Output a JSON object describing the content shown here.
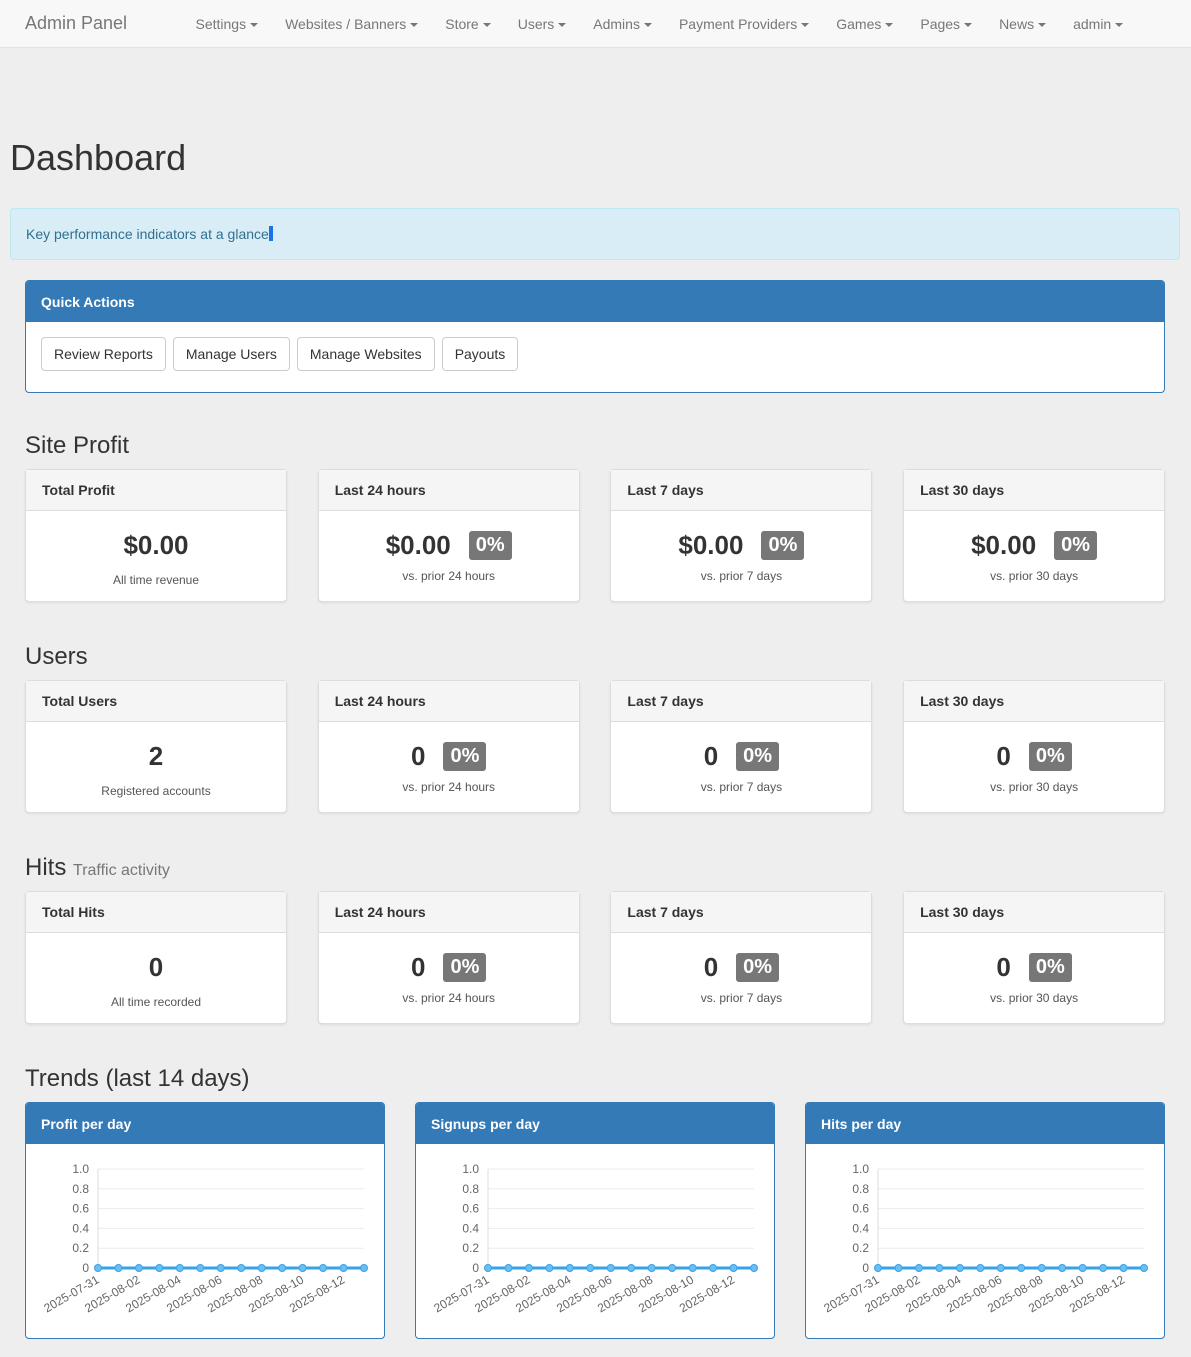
{
  "nav": {
    "brand": "Admin Panel",
    "items": [
      "Settings",
      "Websites / Banners",
      "Store",
      "Users",
      "Admins",
      "Payment Providers",
      "Games",
      "Pages",
      "News",
      "admin"
    ]
  },
  "page_title": "Dashboard",
  "alert": "Key performance indicators at a glance",
  "quick_actions": {
    "title": "Quick Actions",
    "buttons": [
      "Review Reports",
      "Manage Users",
      "Manage Websites",
      "Payouts"
    ]
  },
  "sections": [
    {
      "title": "Site Profit",
      "subtitle": "",
      "cards": [
        {
          "header": "Total Profit",
          "value": "$0.00",
          "badge": "",
          "sub": "All time revenue"
        },
        {
          "header": "Last 24 hours",
          "value": "$0.00",
          "badge": "0%",
          "sub": "vs. prior 24 hours"
        },
        {
          "header": "Last 7 days",
          "value": "$0.00",
          "badge": "0%",
          "sub": "vs. prior 7 days"
        },
        {
          "header": "Last 30 days",
          "value": "$0.00",
          "badge": "0%",
          "sub": "vs. prior 30 days"
        }
      ]
    },
    {
      "title": "Users",
      "subtitle": "",
      "cards": [
        {
          "header": "Total Users",
          "value": "2",
          "badge": "",
          "sub": "Registered accounts"
        },
        {
          "header": "Last 24 hours",
          "value": "0",
          "badge": "0%",
          "sub": "vs. prior 24 hours"
        },
        {
          "header": "Last 7 days",
          "value": "0",
          "badge": "0%",
          "sub": "vs. prior 7 days"
        },
        {
          "header": "Last 30 days",
          "value": "0",
          "badge": "0%",
          "sub": "vs. prior 30 days"
        }
      ]
    },
    {
      "title": "Hits",
      "subtitle": "Traffic activity",
      "cards": [
        {
          "header": "Total Hits",
          "value": "0",
          "badge": "",
          "sub": "All time recorded"
        },
        {
          "header": "Last 24 hours",
          "value": "0",
          "badge": "0%",
          "sub": "vs. prior 24 hours"
        },
        {
          "header": "Last 7 days",
          "value": "0",
          "badge": "0%",
          "sub": "vs. prior 7 days"
        },
        {
          "header": "Last 30 days",
          "value": "0",
          "badge": "0%",
          "sub": "vs. prior 30 days"
        }
      ]
    }
  ],
  "trends_title": "Trends (last 14 days)",
  "chart_data": [
    {
      "type": "line",
      "title": "Profit per day",
      "x": [
        "2025-07-31",
        "2025-08-01",
        "2025-08-02",
        "2025-08-03",
        "2025-08-04",
        "2025-08-05",
        "2025-08-06",
        "2025-08-07",
        "2025-08-08",
        "2025-08-09",
        "2025-08-10",
        "2025-08-11",
        "2025-08-12",
        "2025-08-13"
      ],
      "values": [
        0,
        0,
        0,
        0,
        0,
        0,
        0,
        0,
        0,
        0,
        0,
        0,
        0,
        0
      ],
      "yticks": [
        "0",
        "0.2",
        "0.4",
        "0.6",
        "0.8",
        "1.0"
      ],
      "ylim": [
        0,
        1
      ],
      "xticks_shown": [
        "2025-07-31",
        "2025-08-02",
        "2025-08-04",
        "2025-08-06",
        "2025-08-08",
        "2025-08-10",
        "2025-08-12"
      ],
      "color": "#36a2eb"
    },
    {
      "type": "line",
      "title": "Signups per day",
      "x": [
        "2025-07-31",
        "2025-08-01",
        "2025-08-02",
        "2025-08-03",
        "2025-08-04",
        "2025-08-05",
        "2025-08-06",
        "2025-08-07",
        "2025-08-08",
        "2025-08-09",
        "2025-08-10",
        "2025-08-11",
        "2025-08-12",
        "2025-08-13"
      ],
      "values": [
        0,
        0,
        0,
        0,
        0,
        0,
        0,
        0,
        0,
        0,
        0,
        0,
        0,
        0
      ],
      "yticks": [
        "0",
        "0.2",
        "0.4",
        "0.6",
        "0.8",
        "1.0"
      ],
      "ylim": [
        0,
        1
      ],
      "xticks_shown": [
        "2025-07-31",
        "2025-08-02",
        "2025-08-04",
        "2025-08-06",
        "2025-08-08",
        "2025-08-10",
        "2025-08-12"
      ],
      "color": "#36a2eb"
    },
    {
      "type": "line",
      "title": "Hits per day",
      "x": [
        "2025-07-31",
        "2025-08-01",
        "2025-08-02",
        "2025-08-03",
        "2025-08-04",
        "2025-08-05",
        "2025-08-06",
        "2025-08-07",
        "2025-08-08",
        "2025-08-09",
        "2025-08-10",
        "2025-08-11",
        "2025-08-12",
        "2025-08-13"
      ],
      "values": [
        0,
        0,
        0,
        0,
        0,
        0,
        0,
        0,
        0,
        0,
        0,
        0,
        0,
        0
      ],
      "yticks": [
        "0",
        "0.2",
        "0.4",
        "0.6",
        "0.8",
        "1.0"
      ],
      "ylim": [
        0,
        1
      ],
      "xticks_shown": [
        "2025-07-31",
        "2025-08-02",
        "2025-08-04",
        "2025-08-06",
        "2025-08-08",
        "2025-08-10",
        "2025-08-12"
      ],
      "color": "#36a2eb"
    }
  ]
}
